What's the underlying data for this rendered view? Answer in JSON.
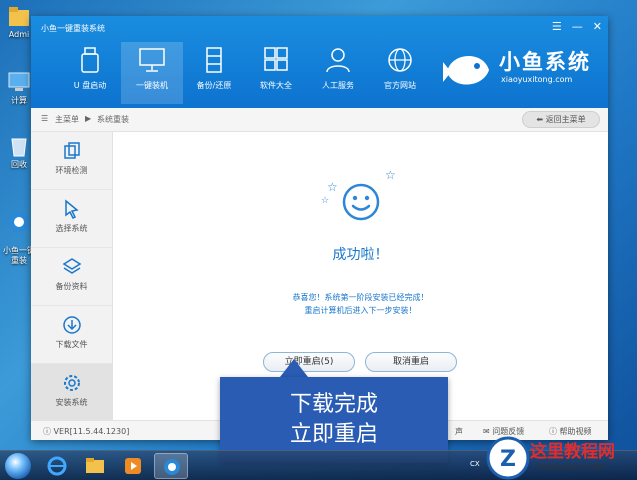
{
  "desktop": {
    "icons": [
      {
        "label": "Admi"
      },
      {
        "label": "计算"
      },
      {
        "label": "回收"
      },
      {
        "label": "小鱼一键\n重装"
      }
    ]
  },
  "window": {
    "title": "小鱼一键重装系统",
    "controls": {
      "menu": "☰",
      "minimize": "—",
      "close": "✕"
    },
    "nav": [
      {
        "label": "U 盘启动"
      },
      {
        "label": "一键装机"
      },
      {
        "label": "备份/还原"
      },
      {
        "label": "软件大全"
      },
      {
        "label": "人工服务"
      },
      {
        "label": "官方网站"
      }
    ],
    "brand": {
      "name": "小鱼系统",
      "url": "xiaoyuxitong.com"
    }
  },
  "breadcrumb": {
    "home": "主菜单",
    "current": "系统重装",
    "back": "返回主菜单"
  },
  "sidebar": [
    {
      "label": "环境检测"
    },
    {
      "label": "选择系统"
    },
    {
      "label": "备份资料"
    },
    {
      "label": "下载文件"
    },
    {
      "label": "安装系统"
    }
  ],
  "main": {
    "success": "成功啦！",
    "line1": "恭喜您！系统第一阶段安装已经完成！",
    "line2": "重启计算机后进入下一步安装！",
    "restart": "立即重启(5)",
    "cancel": "取消重启"
  },
  "footer": {
    "version": "VER[11.5.44.1230]",
    "link1": "声",
    "link2": "问题反馈",
    "link3": "帮助视频"
  },
  "callout": {
    "line1": "下载完成",
    "line2": "立即重启"
  },
  "taskbar": {
    "tray": "CX"
  },
  "watermark": {
    "logo_letter": "Z",
    "name": "这里教程网",
    "url": "herecours.com"
  },
  "colors": {
    "accent": "#0d73cf",
    "text_blue": "#1977cc",
    "callout": "#2a5cb4"
  }
}
